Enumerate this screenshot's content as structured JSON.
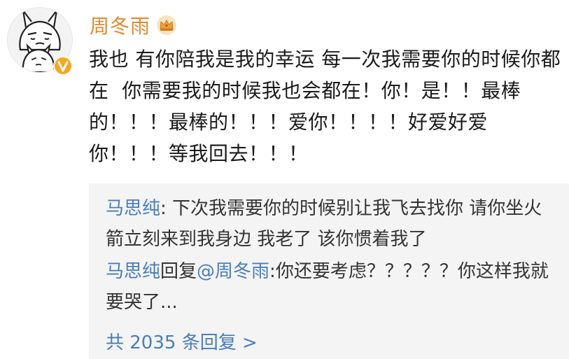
{
  "post": {
    "author": "周冬雨",
    "text": "我也 有你陪我是我的幸运 每一次我需要你的时候你都在  你需要我的时候我也会都在！你！是！！最棒的！！！最棒的！！！爱你！！！！好爱好爱你！！！等我回去！！！"
  },
  "replies": [
    {
      "author": "马思纯",
      "separator": ": ",
      "text": "下次我需要你的时候别让我飞去找你 请你坐火箭立刻来到我身边 我老了 该你惯着我了"
    },
    {
      "author": "马思纯",
      "reply_word": "回复",
      "target": "@周冬雨",
      "separator": ":",
      "text": "你还要考虑？？？？？你这样我就要哭了..."
    }
  ],
  "footer": {
    "total_replies": "共 2035 条回复 >"
  },
  "colors": {
    "author_orange": "#e0892f",
    "link_blue": "#4a7db8",
    "reply_bg": "#f4f4f4",
    "verified_orange": "#f5a623"
  },
  "icons": {
    "avatar": "rabbit-avatar",
    "verified": "verified-icon",
    "crown": "crown-icon"
  }
}
